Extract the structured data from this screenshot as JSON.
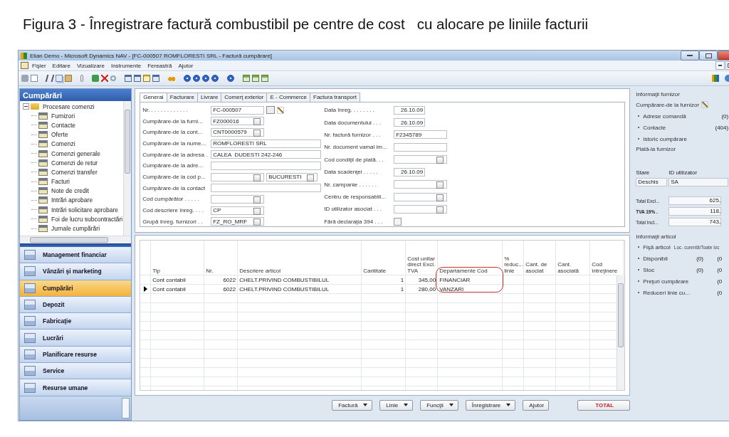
{
  "caption": "Figura 3 - Înregistrare factură combustibil pe centre de cost   cu alocare pe liniile facturii",
  "window": {
    "title": "Elian Demo - Microsoft Dynamics NAV - [FC-000507 ROMFLORESTI SRL - Factură cumpărare]"
  },
  "menu": [
    "Fişier",
    "Editare",
    "Vizualizare",
    "Instrumente",
    "Fereastră",
    "Ajutor"
  ],
  "navigation": {
    "title": "Cumpărări",
    "tree": [
      {
        "label": "Procesare comenzi",
        "expanded": true,
        "children": [
          {
            "label": "Furnizori",
            "selected": false
          },
          {
            "label": "Contacte",
            "selected": false
          },
          {
            "label": "Oferte",
            "selected": false
          },
          {
            "label": "Comenzi",
            "selected": false
          },
          {
            "label": "Comenzi generale",
            "selected": false
          },
          {
            "label": "Comenzi de retur",
            "selected": false
          },
          {
            "label": "Comenzi transfer",
            "selected": false
          },
          {
            "label": "Facturi",
            "selected": false
          },
          {
            "label": "Note de credit",
            "selected": false
          },
          {
            "label": "Intrări aprobare",
            "selected": false
          },
          {
            "label": "Intrări solicitare aprobare",
            "selected": false
          },
          {
            "label": "Foi de lucru subcontractări",
            "selected": false
          },
          {
            "label": "Jurnale cumpărări",
            "selected": false
          }
        ]
      }
    ],
    "modules": [
      {
        "label": "Management financiar",
        "selected": false
      },
      {
        "label": "Vânzări şi marketing",
        "selected": false
      },
      {
        "label": "Cumpărări",
        "selected": true
      },
      {
        "label": "Depozit",
        "selected": false
      },
      {
        "label": "Fabricaţie",
        "selected": false
      },
      {
        "label": "Lucrări",
        "selected": false
      },
      {
        "label": "Planificare resurse",
        "selected": false
      },
      {
        "label": "Service",
        "selected": false
      },
      {
        "label": "Resurse umane",
        "selected": false
      }
    ]
  },
  "form": {
    "tabs": [
      {
        "label": "General",
        "selected": true
      },
      {
        "label": "Facturare",
        "selected": false
      },
      {
        "label": "Livrare",
        "selected": false
      },
      {
        "label": "Comerţ exterior",
        "selected": false
      },
      {
        "label": "E - Commerce",
        "selected": false
      },
      {
        "label": "Factura transport",
        "selected": false
      }
    ],
    "left_fields": [
      {
        "label": "Nr. . . . . . . . . . . . .",
        "value": "FC-000507",
        "kind": "assist"
      },
      {
        "label": "Cumpărare-de la furni...",
        "value": "FZ000016",
        "kind": "lookup"
      },
      {
        "label": "Cumpărare-de la cont...",
        "value": "CNT0000579",
        "kind": "lookup"
      },
      {
        "label": "Cumpărare-de la nume...",
        "value": "ROMFLORESTI SRL",
        "kind": "long"
      },
      {
        "label": "Cumpărare-de la adresa .",
        "value": "CALEA  DUDESTI 242-246",
        "kind": "long"
      },
      {
        "label": "Cumpărare-de la adre...",
        "kind": "long"
      },
      {
        "label": "Cumpărare-de la cod p...",
        "kind": "split",
        "city": "BUCURESTI"
      },
      {
        "label": "Cumpărare-de la contact",
        "kind": "long"
      },
      {
        "label": "Cod cumpărător . . . . .",
        "kind": "lookup"
      },
      {
        "label": "Cod descriere înreg. . . .",
        "value": "CP",
        "kind": "lookup"
      },
      {
        "label": "Grupă înreg. furnizori . .",
        "value": "FZ_RO_MRF",
        "kind": "lookup"
      }
    ],
    "right_fields": [
      {
        "label": "Data înreg. . . . . . . .",
        "value": "26.10.09",
        "kind": "date"
      },
      {
        "label": "Data documentului . . .",
        "value": "26.10.09",
        "kind": "date"
      },
      {
        "label": "Nr. factură furnizor . . .",
        "value": "F2345789",
        "kind": "long"
      },
      {
        "label": "Nr. document vamal im...",
        "kind": "long"
      },
      {
        "label": "Cod condiţii de plată. . .",
        "kind": "lookup"
      },
      {
        "label": "Data scadenţei . . . . .",
        "value": "26.10.09",
        "kind": "date"
      },
      {
        "label": "Nr. campanie . . . . . .",
        "kind": "lookup"
      },
      {
        "label": "Centru de responsabili...",
        "kind": "lookup"
      },
      {
        "label": "ID utilizator asociat . . .",
        "kind": "lookup"
      },
      {
        "label": "Fără declaraţia 394 . . .",
        "kind": "checkbox",
        "checked": false
      }
    ]
  },
  "lines": {
    "columns": [
      {
        "label": "Tip",
        "kind": "text",
        "highlighted": false
      },
      {
        "label": "Nr.",
        "kind": "number",
        "highlighted": false
      },
      {
        "label": "Descriere articol",
        "kind": "text",
        "highlighted": false
      },
      {
        "label": "Cantitate",
        "kind": "number",
        "highlighted": false
      },
      {
        "label": "Cost unitar direct Excl. TVA",
        "kind": "number",
        "highlighted": false
      },
      {
        "label": "Departamente Cod",
        "kind": "text",
        "highlighted": true
      },
      {
        "label": "% reduc... linie",
        "kind": "number",
        "highlighted": false
      },
      {
        "label": "Cant. de asociat",
        "kind": "number",
        "highlighted": false
      },
      {
        "label": "Cant. asociată",
        "kind": "number",
        "highlighted": false
      },
      {
        "label": "Cod întreţinere",
        "kind": "text",
        "highlighted": false
      }
    ],
    "rows": [
      {
        "selected": false,
        "cells": [
          "Cont contabil",
          "6022",
          "CHELT.PRIVIND COMBUSTIBILUL",
          "1",
          "345,00",
          "FINANCIAR"
        ]
      },
      {
        "selected": true,
        "cells": [
          "Cont contabil",
          "6022",
          "CHELT.PRIVIND COMBUSTIBILUL",
          "1",
          "280,00",
          "VANZARI"
        ]
      }
    ]
  },
  "actions": [
    {
      "label": "Factură",
      "kind": "menu"
    },
    {
      "label": "Linie",
      "kind": "menu"
    },
    {
      "label": "Funcţii",
      "kind": "menu"
    },
    {
      "label": "Înregistrare",
      "kind": "menu"
    },
    {
      "label": "Ajutor",
      "kind": "plain"
    },
    {
      "label": "TOTAL",
      "kind": "total"
    }
  ],
  "vendor_info": {
    "title": "Informaţii furnizor",
    "heading": "Cumpărare-de la furnizor",
    "links": [
      {
        "label": "Adrese comandă",
        "count": "(0)"
      },
      {
        "label": "Contacte",
        "count": "(404)"
      },
      {
        "label": "Istoric cumpărare"
      }
    ],
    "subheading": "Plată-la furnizor",
    "status": [
      {
        "label": "Stare",
        "value": "Deschis"
      },
      {
        "label": "ID utilizator",
        "value": "SA"
      }
    ],
    "totals": [
      {
        "label": "Total Excl...",
        "value": "625,"
      },
      {
        "label": "TVA 19% .",
        "value": "118,"
      },
      {
        "label": "Total Incl...",
        "value": "743,"
      }
    ]
  },
  "item_info": {
    "title": "Informaţii articol",
    "heading": "Fişă articol",
    "note": "Loc. curentă/Toate loc",
    "links": [
      {
        "label": "Disponibil",
        "counts": [
          "(0)",
          "(0"
        ]
      },
      {
        "label": "Stoc",
        "counts": [
          "(0)",
          "(0"
        ]
      },
      {
        "label": "Preţuri cumpărare",
        "counts": [
          "(0"
        ]
      },
      {
        "label": "Reduceri linie cu...",
        "counts": [
          "(0"
        ]
      }
    ]
  }
}
